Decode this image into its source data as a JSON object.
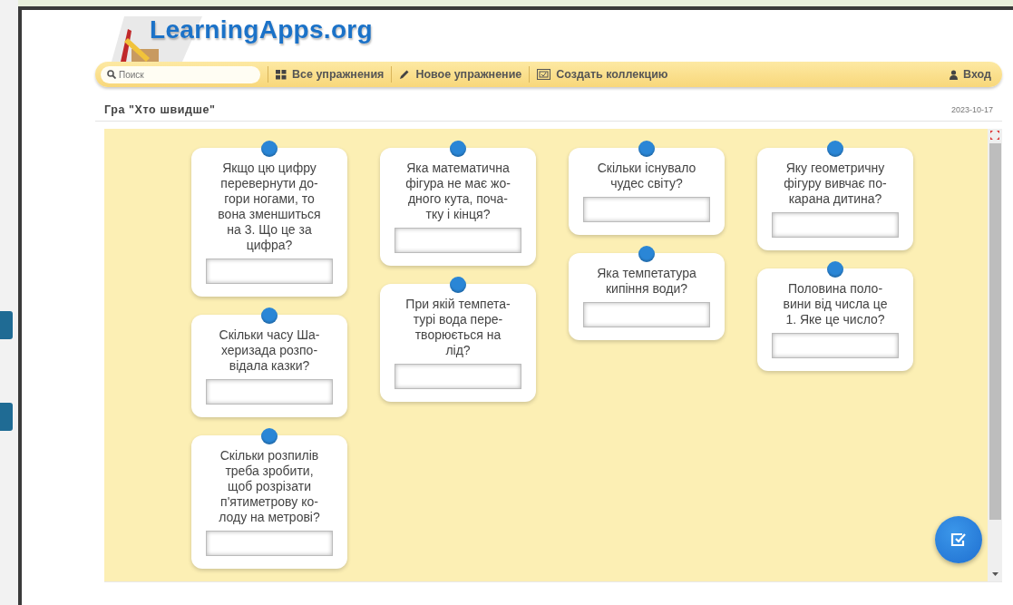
{
  "site": {
    "logo": "LearningApps.org"
  },
  "nav": {
    "search": {
      "placeholder": "Поиск"
    },
    "items": [
      {
        "kind": "grid",
        "label": "Все упражнения"
      },
      {
        "kind": "pencil",
        "label": "Новое упражнение"
      },
      {
        "kind": "collection",
        "label": "Создать коллекцию"
      }
    ],
    "login": "Вход"
  },
  "app": {
    "title": "Гра \"Хто швидше\"",
    "date": "2023-10-17"
  },
  "columns": [
    [
      {
        "question": "Якщо цю цифру\nперевернути до-\nгори ногами, то\nвона зменшиться\nна 3. Що це за\nцифра?"
      },
      {
        "question": "Скільки часу Ша-\nхеризада розпо-\nвідала казки?"
      },
      {
        "question": "Скільки розпилів\nтреба зробити,\nщоб розрізати\nп'ятиметрову ко-\nлоду на метрові?"
      }
    ],
    [
      {
        "question": "Яка математична\nфігура не має жо-\nдного кута, поча-\nтку і кінця?"
      },
      {
        "question": "При якій темпета-\nтурі вода пере-\nтворюється на\nлід?"
      }
    ],
    [
      {
        "question": "Скільки існувало\nчудес світу?"
      },
      {
        "question": "Яка темпетатура\nкипіння води?"
      }
    ],
    [
      {
        "question": "Яку геометричну\nфігуру вивчає по-\nкарана дитина?"
      },
      {
        "question": "Половина поло-\nвини від числа це\n1. Яке це число?"
      }
    ]
  ]
}
